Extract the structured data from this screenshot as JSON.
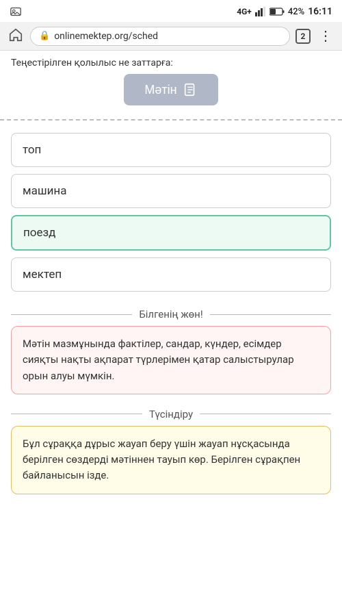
{
  "statusBar": {
    "signal": "4G+",
    "battery": "42%",
    "time": "16:11"
  },
  "browserBar": {
    "url": "onlinemektep.org/sched",
    "tabCount": "2"
  },
  "topSection": {
    "hintText": "Теңестірілген қолылыс не заттарға:",
    "buttonLabel": "Мәтін"
  },
  "options": [
    {
      "id": "opt1",
      "text": "топ",
      "selected": false
    },
    {
      "id": "opt2",
      "text": "машина",
      "selected": false
    },
    {
      "id": "opt3",
      "text": "поезд",
      "selected": true
    },
    {
      "id": "opt4",
      "text": "мектеп",
      "selected": false
    }
  ],
  "infoSection1": {
    "label": "Білгенің жөн!",
    "text": "Мәтін мазмұнында фактілер, сандар, күндер, есімдер сияқты нақты ақпарат түрлерімен қатар салыстырулар орын алуы мүмкін."
  },
  "infoSection2": {
    "label": "Түсіндіру",
    "text": "Бұл сұраққа дұрыс жауап беру үшін жауап нұсқасында берілген сөздерді мәтіннен тауып көр. Берілген сұрақпен байланысын іздe."
  }
}
